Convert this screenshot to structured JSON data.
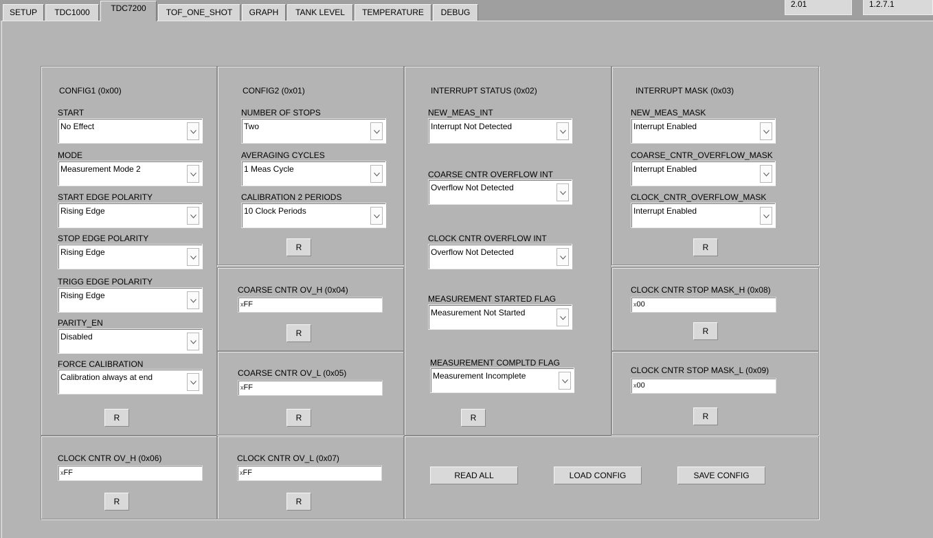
{
  "tabs": [
    {
      "label": "SETUP"
    },
    {
      "label": "TDC1000"
    },
    {
      "label": "TDC7200"
    },
    {
      "label": "TOF_ONE_SHOT"
    },
    {
      "label": "GRAPH"
    },
    {
      "label": "TANK LEVEL"
    },
    {
      "label": "TEMPERATURE"
    },
    {
      "label": "DEBUG"
    }
  ],
  "versions": {
    "firmware": "2.01",
    "software": "1.2.7.1"
  },
  "config1": {
    "title": "CONFIG1 (0x00)",
    "start": {
      "label": "START",
      "value": "No Effect"
    },
    "mode": {
      "label": "MODE",
      "value": "Measurement Mode 2"
    },
    "start_edge": {
      "label": "START EDGE POLARITY",
      "value": "Rising Edge"
    },
    "stop_edge": {
      "label": "STOP EDGE POLARITY",
      "value": "Rising Edge"
    },
    "trigg_edge": {
      "label": "TRIGG EDGE POLARITY",
      "value": "Rising Edge"
    },
    "parity": {
      "label": "PARITY_EN",
      "value": "Disabled"
    },
    "force_cal": {
      "label": "FORCE CALIBRATION",
      "value": "Calibration always at end"
    },
    "read_label": "R"
  },
  "config2": {
    "title": "CONFIG2 (0x01)",
    "num_stops": {
      "label": "NUMBER OF STOPS",
      "value": "Two"
    },
    "avg_cycles": {
      "label": "AVERAGING CYCLES",
      "value": "1 Meas Cycle"
    },
    "cal2_periods": {
      "label": "CALIBRATION 2 PERIODS",
      "value": "10 Clock Periods"
    },
    "read_label": "R"
  },
  "int_status": {
    "title": "INTERRUPT STATUS (0x02)",
    "new_meas": {
      "label": "NEW_MEAS_INT",
      "value": "Interrupt Not Detected"
    },
    "coarse_ovf": {
      "label": "COARSE CNTR OVERFLOW INT",
      "value": "Overflow Not Detected"
    },
    "clock_ovf": {
      "label": "CLOCK CNTR OVERFLOW INT",
      "value": "Overflow Not Detected"
    },
    "meas_started": {
      "label": "MEASUREMENT STARTED FLAG",
      "value": "Measurement Not Started"
    },
    "meas_compltd": {
      "label": "MEASUREMENT COMPLTD FLAG",
      "value": "Measurement Incomplete"
    },
    "read_label": "R"
  },
  "int_mask": {
    "title": "INTERRUPT MASK (0x03)",
    "new_meas_mask": {
      "label": "NEW_MEAS_MASK",
      "value": "Interrupt Enabled"
    },
    "coarse_mask": {
      "label": "COARSE_CNTR_OVERFLOW_MASK",
      "value": "Interrupt Enabled"
    },
    "clock_mask": {
      "label": "CLOCK_CNTR_OVERFLOW_MASK",
      "value": "Interrupt Enabled"
    },
    "read_label": "R"
  },
  "coarse_ov_h": {
    "label": "COARSE CNTR OV_H (0x04)",
    "prefix": "x",
    "value": "FF",
    "read_label": "R"
  },
  "coarse_ov_l": {
    "label": "COARSE CNTR OV_L (0x05)",
    "prefix": "x",
    "value": "FF",
    "read_label": "R"
  },
  "clock_ov_h": {
    "label": "CLOCK CNTR OV_H (0x06)",
    "prefix": "x",
    "value": "FF",
    "read_label": "R"
  },
  "clock_ov_l": {
    "label": "CLOCK CNTR OV_L (0x07)",
    "prefix": "x",
    "value": "FF",
    "read_label": "R"
  },
  "stop_mask_h": {
    "label": "CLOCK CNTR STOP MASK_H (0x08)",
    "prefix": "x",
    "value": "00",
    "read_label": "R"
  },
  "stop_mask_l": {
    "label": "CLOCK CNTR STOP MASK_L (0x09)",
    "prefix": "x",
    "value": "00",
    "read_label": "R"
  },
  "actions": {
    "read_all": "READ ALL",
    "load_config": "LOAD CONFIG",
    "save_config": "SAVE CONFIG"
  }
}
